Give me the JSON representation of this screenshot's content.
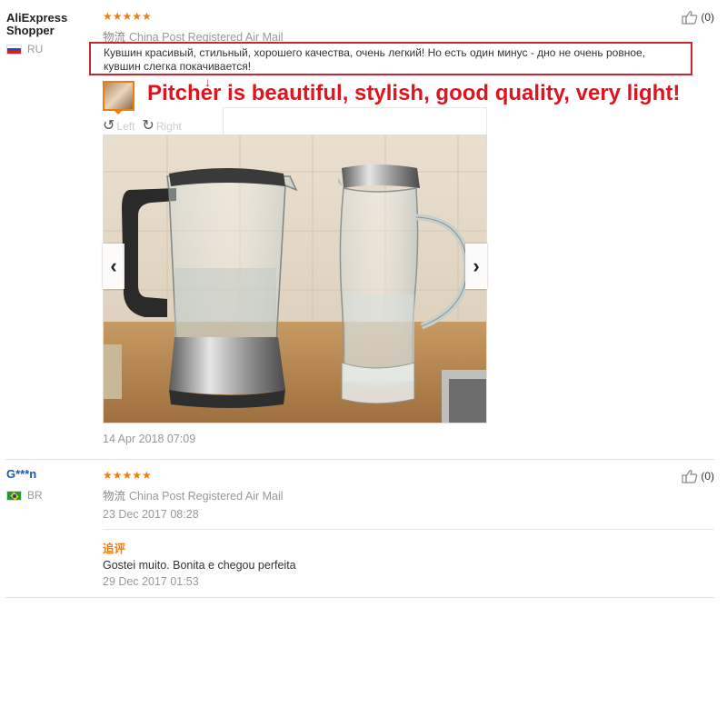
{
  "reviews": [
    {
      "user": "AliExpress Shopper",
      "country": "RU",
      "stars": "★★★★★",
      "logistics_label": "物流",
      "logistics": "China Post Registered Air Mail",
      "helpful_count": "(0)",
      "text": "Кувшин красивый, стильный, хорошего качества, очень легкий! Но есть один минус - дно не очень ровное, кувшин слегка покачивается!",
      "annotation": "Pitcher is beautiful, stylish, good quality, very light!",
      "arrow": "↓",
      "rotate_left": "Left",
      "rotate_right": "Right",
      "prev": "‹",
      "next": "›",
      "date": "14 Apr 2018 07:09"
    },
    {
      "user": "G***n",
      "country": "BR",
      "stars": "★★★★★",
      "logistics_label": "物流",
      "logistics": "China Post Registered Air Mail",
      "helpful_count": "(0)",
      "date": "23 Dec 2017 08:28",
      "followup_label": "追评",
      "followup_text": "Gostei muito. Bonita e chegou perfeita",
      "followup_date": "29 Dec 2017 01:53"
    }
  ],
  "colors": {
    "accent": "#f07c0d",
    "highlight": "#c8262c",
    "annotation": "#e0141e"
  }
}
